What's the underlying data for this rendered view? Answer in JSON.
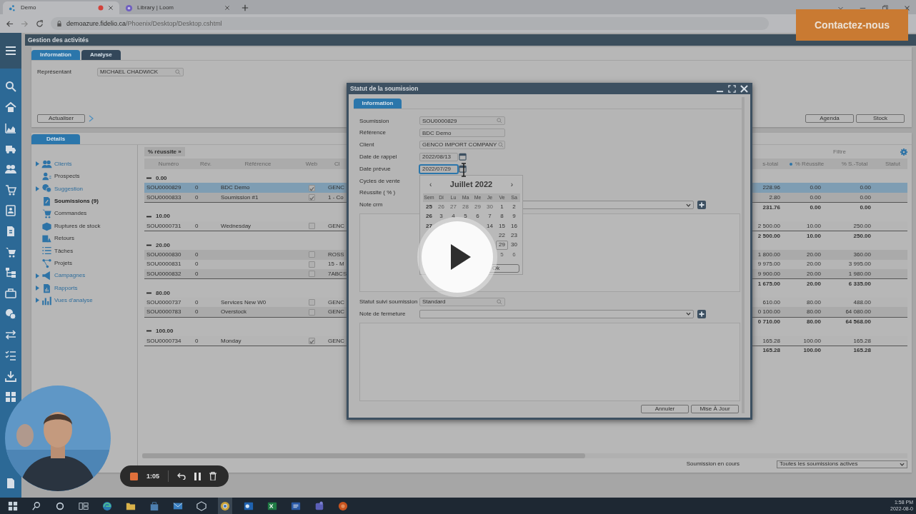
{
  "browser": {
    "tabs": [
      {
        "title": "Demo",
        "selected": true,
        "recording": true
      },
      {
        "title": "Library | Loom",
        "selected": false,
        "recording": false
      }
    ],
    "address": {
      "host": "demoazure.fidelio.ca",
      "path": "/Phoenix/Desktop/Desktop.cshtml"
    }
  },
  "contact_button": "Contactez-nous",
  "app": {
    "title": "Gestion des activités",
    "tabs": [
      {
        "label": "Information",
        "selected": true
      },
      {
        "label": "Analyse",
        "selected": false
      }
    ],
    "representative": {
      "label": "Représentant",
      "value": "MICHAEL CHADWICK"
    },
    "refresh_button": "Actualiser",
    "buttons": [
      "Agenda",
      "Stock"
    ]
  },
  "details": {
    "tab": "Détails",
    "tree": [
      {
        "label": "Clients",
        "kind": "group",
        "selected": false
      },
      {
        "label": "Prospects",
        "kind": "page",
        "selected": false
      },
      {
        "label": "Suggestion",
        "kind": "group",
        "selected": false
      },
      {
        "label": "Soumissions (9)",
        "kind": "page",
        "selected": true
      },
      {
        "label": "Commandes",
        "kind": "page",
        "selected": false
      },
      {
        "label": "Ruptures de stock",
        "kind": "page",
        "selected": false
      },
      {
        "label": "Retours",
        "kind": "page",
        "selected": false
      },
      {
        "label": "Tâches",
        "kind": "page",
        "selected": false
      },
      {
        "label": "Projets",
        "kind": "page",
        "selected": false
      },
      {
        "label": "Campagnes",
        "kind": "group",
        "selected": false
      },
      {
        "label": "Rapports",
        "kind": "group",
        "selected": false
      },
      {
        "label": "Vues d'analyse",
        "kind": "group",
        "selected": false
      }
    ],
    "group_tag": "% réussite »",
    "filter": {
      "placeholder": "Filtre"
    }
  },
  "table": {
    "columns_left": [
      "Numéro",
      "Rév.",
      "Référence",
      "Web",
      "Cl"
    ],
    "columns_right": [
      "s-total",
      "% Réussite",
      "% S.-Total",
      "Statut"
    ],
    "groups": [
      {
        "label": "0.00",
        "expanded": true,
        "rows": [
          {
            "number": "SOU0000829",
            "rev": "0",
            "reference": "BDC Demo",
            "web": true,
            "client": "GENC",
            "subtotal": "228.96",
            "success": "0.00",
            "share": "0.00",
            "selected": true
          },
          {
            "number": "SOU0000833",
            "rev": "0",
            "reference": "Soumission #1",
            "web": true,
            "client": "1 - Co",
            "subtotal": "2.80",
            "success": "0.00",
            "share": "0.00",
            "selected": false
          }
        ],
        "totals": {
          "subtotal": "231.76",
          "success": "0.00",
          "share": "0.00"
        }
      },
      {
        "label": "10.00",
        "expanded": true,
        "rows": [
          {
            "number": "SOU0000731",
            "rev": "0",
            "reference": "Wednesday",
            "web": false,
            "client": "GENC",
            "subtotal": "2 500.00",
            "success": "10.00",
            "share": "250.00",
            "selected": false
          }
        ],
        "totals": {
          "subtotal": "2 500.00",
          "success": "10.00",
          "share": "250.00"
        }
      },
      {
        "label": "20.00",
        "expanded": true,
        "rows": [
          {
            "number": "SOU0000830",
            "rev": "0",
            "web": false,
            "client": "ROSS",
            "subtotal": "1 800.00",
            "success": "20.00",
            "share": "360.00",
            "selected": false
          },
          {
            "number": "SOU0000831",
            "rev": "0",
            "web": false,
            "client": "15 - M",
            "subtotal": "9 975.00",
            "success": "20.00",
            "share": "3 995.00",
            "selected": false
          },
          {
            "number": "SOU0000832",
            "rev": "0",
            "web": false,
            "client": "7ABCS",
            "subtotal": "9 900.00",
            "success": "20.00",
            "share": "1 980.00",
            "selected": false
          }
        ],
        "totals": {
          "subtotal": "1 675.00",
          "success": "20.00",
          "share": "6 335.00"
        }
      },
      {
        "label": "80.00",
        "expanded": true,
        "rows": [
          {
            "number": "SOU0000737",
            "rev": "0",
            "reference": "Services New W0",
            "web": false,
            "client": "GENC",
            "subtotal": "610.00",
            "success": "80.00",
            "share": "488.00",
            "selected": false
          },
          {
            "number": "SOU0000783",
            "rev": "0",
            "reference": "Overstock",
            "web": false,
            "client": "GENC",
            "subtotal": "0 100.00",
            "success": "80.00",
            "share": "64 080.00",
            "selected": false
          }
        ],
        "totals": {
          "subtotal": "0 710.00",
          "success": "80.00",
          "share": "64 568.00"
        }
      },
      {
        "label": "100.00",
        "expanded": true,
        "rows": [
          {
            "number": "SOU0000734",
            "rev": "0",
            "reference": "Monday",
            "web": true,
            "client": "GENC",
            "subtotal": "165.28",
            "success": "100.00",
            "share": "165.28",
            "selected": false
          }
        ],
        "totals": {
          "subtotal": "165.28",
          "success": "100.00",
          "share": "165.28"
        }
      }
    ]
  },
  "footer": {
    "label": "Soumission en cours",
    "select": "Toutes les soumissions actives"
  },
  "dialog": {
    "title": "Statut de la soumission",
    "tab": {
      "label": "Information",
      "selected": true
    },
    "fields": [
      {
        "label": "Soumission",
        "value": "SOU0000829",
        "kind": "lookup",
        "focused": false
      },
      {
        "label": "Référence",
        "value": "BDC Demo",
        "kind": "text",
        "focused": false
      },
      {
        "label": "Client",
        "value": "GENCO IMPORT COMPANY",
        "kind": "lookup",
        "focused": false
      },
      {
        "label": "Date de rappel",
        "value": "2022/08/13",
        "kind": "date",
        "focused": false
      },
      {
        "label": "Date prévue",
        "value": "2022/07/29",
        "kind": "date",
        "focused": true
      },
      {
        "label": "Cycles de vente",
        "kind": "label"
      },
      {
        "label": "Réussite ( % )",
        "kind": "label"
      },
      {
        "label": "Note crm",
        "kind": "select",
        "focused": false
      },
      {
        "kind": "memo"
      },
      {
        "label": "Statut suivi soumission",
        "value": "Standard",
        "kind": "lookup",
        "focused": false
      },
      {
        "label": "Note de fermeture",
        "kind": "select",
        "focused": false
      },
      {
        "kind": "memo"
      }
    ],
    "buttons": [
      "Annuler",
      "Mise À Jour"
    ]
  },
  "calendar": {
    "prev": "‹",
    "title": "Juillet 2022",
    "next": "›",
    "headers": [
      "Sem",
      "Di",
      "Lu",
      "Ma",
      "Me",
      "Je",
      "Ve",
      "Sa"
    ],
    "weeks": [
      {
        "week": "25",
        "days": [
          {
            "day": "26",
            "muted": true,
            "selected": false
          },
          {
            "day": "27",
            "muted": true,
            "selected": false
          },
          {
            "day": "28",
            "muted": true,
            "selected": false
          },
          {
            "day": "29",
            "muted": true,
            "selected": false
          },
          {
            "day": "30",
            "muted": true,
            "selected": false
          },
          {
            "day": "1",
            "muted": false,
            "selected": false
          },
          {
            "day": "2",
            "muted": false,
            "selected": false
          }
        ]
      },
      {
        "week": "26",
        "days": [
          {
            "day": "3",
            "muted": false,
            "selected": false
          },
          {
            "day": "4",
            "muted": false,
            "selected": false
          },
          {
            "day": "5",
            "muted": false,
            "selected": false
          },
          {
            "day": "6",
            "muted": false,
            "selected": false
          },
          {
            "day": "7",
            "muted": false,
            "selected": false
          },
          {
            "day": "8",
            "muted": false,
            "selected": false
          },
          {
            "day": "9",
            "muted": false,
            "selected": false
          }
        ]
      },
      {
        "week": "27",
        "days": [
          {
            "day": "14",
            "muted": false,
            "selected": false
          },
          {
            "day": "15",
            "muted": false,
            "selected": false
          },
          {
            "day": "16",
            "muted": false,
            "selected": false
          }
        ]
      },
      {
        "days": [
          {
            "day": "22",
            "muted": false,
            "selected": false
          },
          {
            "day": "23",
            "muted": false,
            "selected": false
          }
        ]
      },
      {
        "days": [
          {
            "day": "29",
            "muted": false,
            "selected": true
          },
          {
            "day": "30",
            "muted": false,
            "selected": false
          }
        ]
      },
      {
        "days": [
          {
            "day": "5",
            "muted": true,
            "selected": false
          },
          {
            "day": "6",
            "muted": true,
            "selected": false
          }
        ]
      }
    ],
    "ok": "Ok"
  },
  "recorder": {
    "time": "1:05"
  },
  "taskbar": {
    "time": "1:58 PM",
    "date": "2022-08-0"
  }
}
